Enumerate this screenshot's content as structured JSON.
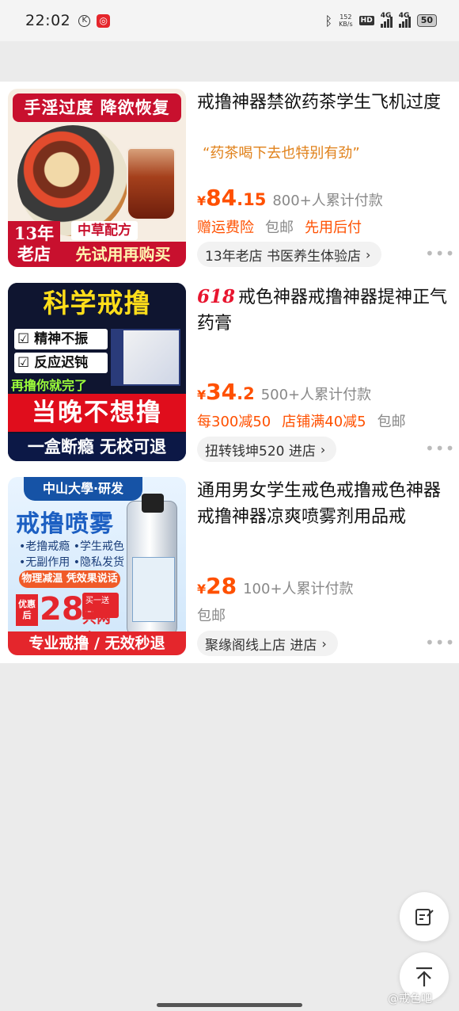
{
  "status_bar": {
    "time": "22:02",
    "speed_value": "152",
    "speed_unit": "KB/s",
    "hd_label": "HD",
    "net1": "4G",
    "net2": "4G",
    "battery": "50",
    "icons": [
      "k-circle-icon",
      "app-notification-icon",
      "bluetooth-icon",
      "hd-icon",
      "signal-icon",
      "battery-icon"
    ]
  },
  "items": [
    {
      "title": "戒撸神器禁欲药茶学生飞机过度",
      "quote": "“药茶喝下去也特别有劲”",
      "price_int": "84",
      "price_dec": ".15",
      "currency": "¥",
      "sold": "800+人累计付款",
      "tags": [
        "赠运费险",
        "包邮",
        "先用后付"
      ],
      "shop": "13年老店 书医养生体验店",
      "thumb": {
        "banner": "手淫过度 降欲恢复",
        "age_line1": "13年",
        "age_line2": "老店",
        "badge": "中草配方",
        "footer": "先试用再购买"
      }
    },
    {
      "prefix": "618",
      "title": "戒色神器戒撸神器提神正气药膏",
      "price_int": "34",
      "price_dec": ".2",
      "currency": "¥",
      "sold": "500+人累计付款",
      "tags": [
        "每300减50",
        "店铺满40减5",
        "包邮"
      ],
      "shop": "扭转钱坤520 进店",
      "thumb": {
        "headline": "科学戒撸",
        "line1": "精神不振",
        "line2": "反应迟钝",
        "line3": "再撸你就完了",
        "red_band": "当晚不想撸",
        "bottom": "一盒断瘾 无校可退"
      }
    },
    {
      "title": "通用男女学生戒色戒撸戒色神器戒撸神器凉爽喷雾剂用品戒",
      "price_int": "28",
      "price_dec": "",
      "currency": "¥",
      "sold": "100+人累计付款",
      "tags": [
        "包邮"
      ],
      "shop": "聚缘阁线上店 进店",
      "thumb": {
        "university": "中山大學·研发",
        "headline": "戒撸喷雾",
        "features": "•老撸戒瘾 •学生戒色\n•无副作用 •隐私发货",
        "warm": "物理减温 凭效果说话",
        "discount_label": "优惠后",
        "price": "28",
        "buy_one": "买一送一",
        "two_boxes": "共两盒",
        "footer": "专业戒撸 / 无效秒退"
      }
    }
  ],
  "more_label": "•••",
  "watermark": "@戒色吧",
  "fabs": [
    "feedback-icon",
    "back-to-top-icon"
  ]
}
